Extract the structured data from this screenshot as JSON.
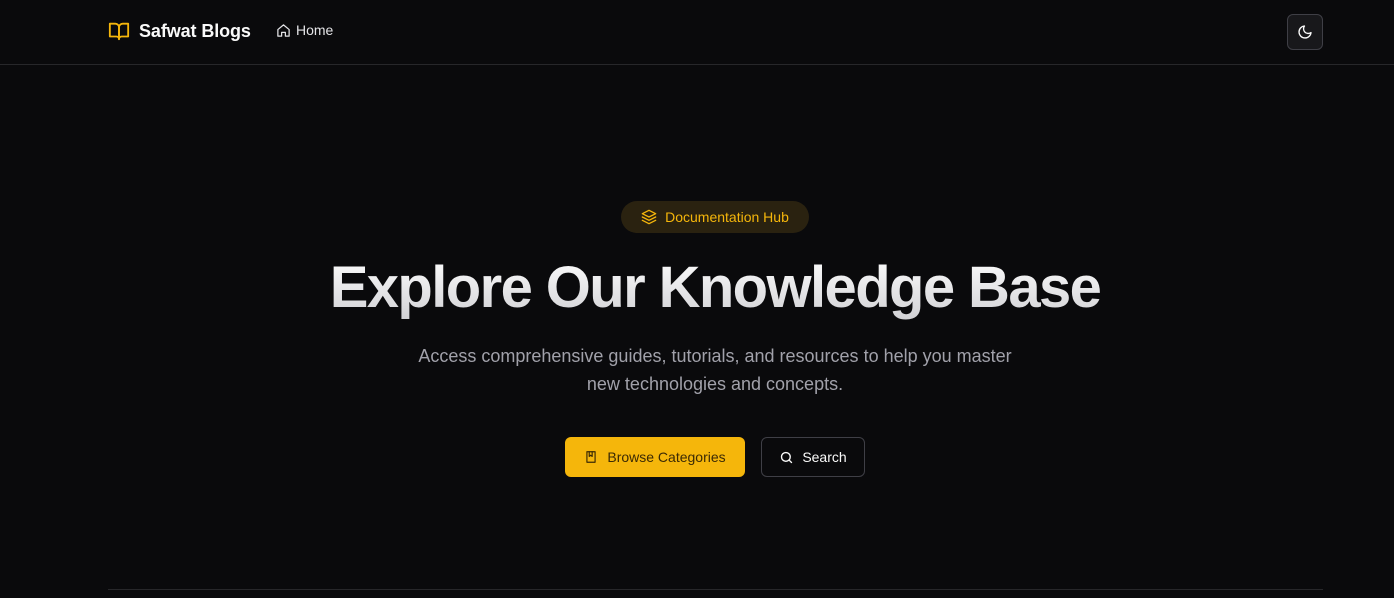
{
  "header": {
    "brand_name": "Safwat Blogs",
    "brand_icon": "book-open-icon",
    "nav": [
      {
        "label": "Home",
        "icon": "home-icon"
      }
    ],
    "theme_toggle_icon": "moon-icon"
  },
  "hero": {
    "badge": {
      "label": "Documentation Hub",
      "icon": "layers-icon"
    },
    "title": "Explore Our Knowledge Base",
    "subtitle_line1": "Access comprehensive guides, tutorials, and resources to help you master",
    "subtitle_line2": "new technologies and concepts.",
    "primary_button": {
      "label": "Browse Categories",
      "icon": "book-icon"
    },
    "secondary_button": {
      "label": "Search",
      "icon": "search-icon"
    }
  },
  "colors": {
    "background": "#0a0a0c",
    "accent": "#f5b60b",
    "muted_text": "#a1a1aa",
    "border": "#27272a"
  }
}
